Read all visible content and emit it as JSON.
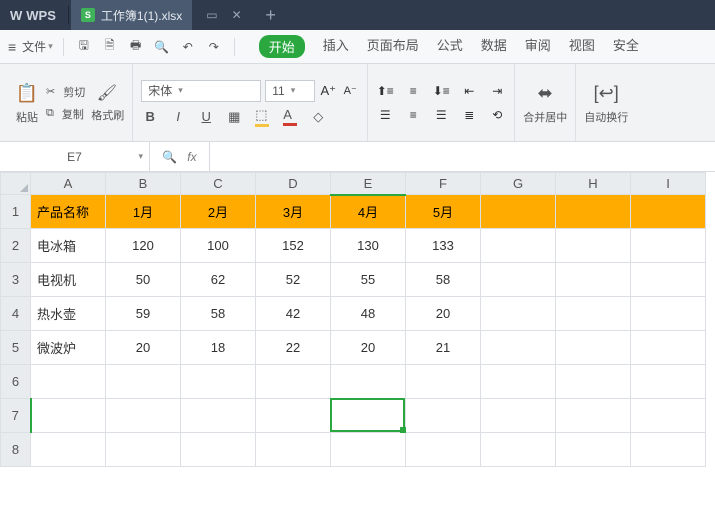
{
  "titlebar": {
    "app": "WPS",
    "doc_icon_letter": "S",
    "tab_title": "工作簿1(1).xlsx",
    "newtab": "+"
  },
  "menubar": {
    "file_label": "文件",
    "ribbon": {
      "start": "开始",
      "insert": "插入",
      "page": "页面布局",
      "formula": "公式",
      "data": "数据",
      "review": "审阅",
      "view": "视图",
      "security": "安全"
    }
  },
  "toolbar": {
    "paste": "粘贴",
    "cut": "剪切",
    "copy": "复制",
    "format_painter": "格式刷",
    "font_name": "宋体",
    "font_size": "11",
    "merge": "合并居中",
    "wrap": "自动换行"
  },
  "namebox": {
    "value": "E7"
  },
  "fx": {
    "symbol": "fx"
  },
  "columns": [
    "A",
    "B",
    "C",
    "D",
    "E",
    "F",
    "G",
    "H",
    "I"
  ],
  "header_row": {
    "prod_label": "产品名称",
    "months": [
      "1月",
      "2月",
      "3月",
      "4月",
      "5月"
    ]
  },
  "rows": [
    {
      "name": "电冰箱",
      "vals": [
        "120",
        "100",
        "152",
        "130",
        "133"
      ]
    },
    {
      "name": "电视机",
      "vals": [
        "50",
        "62",
        "52",
        "55",
        "58"
      ]
    },
    {
      "name": "热水壶",
      "vals": [
        "59",
        "58",
        "42",
        "48",
        "20"
      ]
    },
    {
      "name": "微波炉",
      "vals": [
        "20",
        "18",
        "22",
        "20",
        "21"
      ]
    }
  ],
  "chart_data": {
    "type": "table",
    "title": "",
    "columns": [
      "产品名称",
      "1月",
      "2月",
      "3月",
      "4月",
      "5月"
    ],
    "rows": [
      [
        "电冰箱",
        120,
        100,
        152,
        130,
        133
      ],
      [
        "电视机",
        50,
        62,
        52,
        55,
        58
      ],
      [
        "热水壶",
        59,
        58,
        42,
        48,
        20
      ],
      [
        "微波炉",
        20,
        18,
        22,
        20,
        21
      ]
    ]
  },
  "active_cell": {
    "col_index": 4,
    "row_index": 7
  }
}
